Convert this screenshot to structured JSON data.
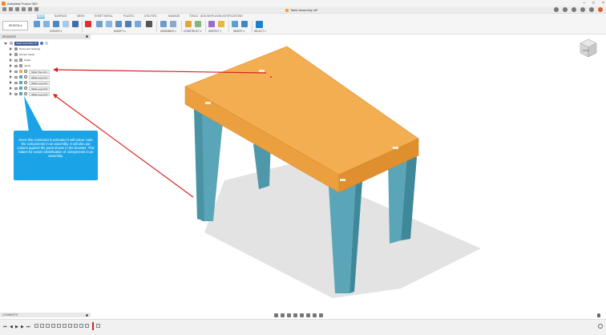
{
  "window": {
    "app_title": "Autodesk Fusion 360",
    "document_tab": "Table Assembly v8*"
  },
  "ribbon": {
    "tabs": [
      "SOLID",
      "SURFACE",
      "MESH",
      "SHEET METAL",
      "PLASTIC",
      "UTILITIES",
      "MANAGE",
      "TOOLS",
      "ADD-INS",
      "PLUGIN-NOTIFICATIONS"
    ],
    "active_tab": "SOLID",
    "workspace_button": "DESIGN ▾",
    "groups": [
      "CREATE ▾",
      "MODIFY ▾",
      "ASSEMBLE ▾",
      "CONSTRUCT ▾",
      "INSPECT ▾",
      "INSERT ▾",
      "SELECT ▾"
    ]
  },
  "browser": {
    "header": "BROWSER",
    "root": "Table Assembly v8",
    "items": [
      {
        "label": "Document Settings"
      },
      {
        "label": "Named Views"
      },
      {
        "label": "Origin"
      },
      {
        "label": "Joints"
      },
      {
        "label": "Table Top v4:1"
      },
      {
        "label": "Table Leg v4:1"
      },
      {
        "label": "Table Leg v4:2"
      },
      {
        "label": "Table Leg v4:3"
      },
      {
        "label": "Table Leg v4:4"
      }
    ]
  },
  "callout": {
    "text": "Once this command is activated it will colour code the components in an assembly. It will also put colours against the parts shown in the browser. This makes for easier identification of components in an assembly."
  },
  "viewcube": {
    "face_label": "FRONT"
  },
  "comments": {
    "label": "COMMENTS"
  },
  "colors": {
    "table_top": "#f0a94a",
    "table_legs": "#5aa6b8",
    "callout": "#1aa3e6",
    "arrows": "#d82222",
    "accent": "#0696d7"
  }
}
